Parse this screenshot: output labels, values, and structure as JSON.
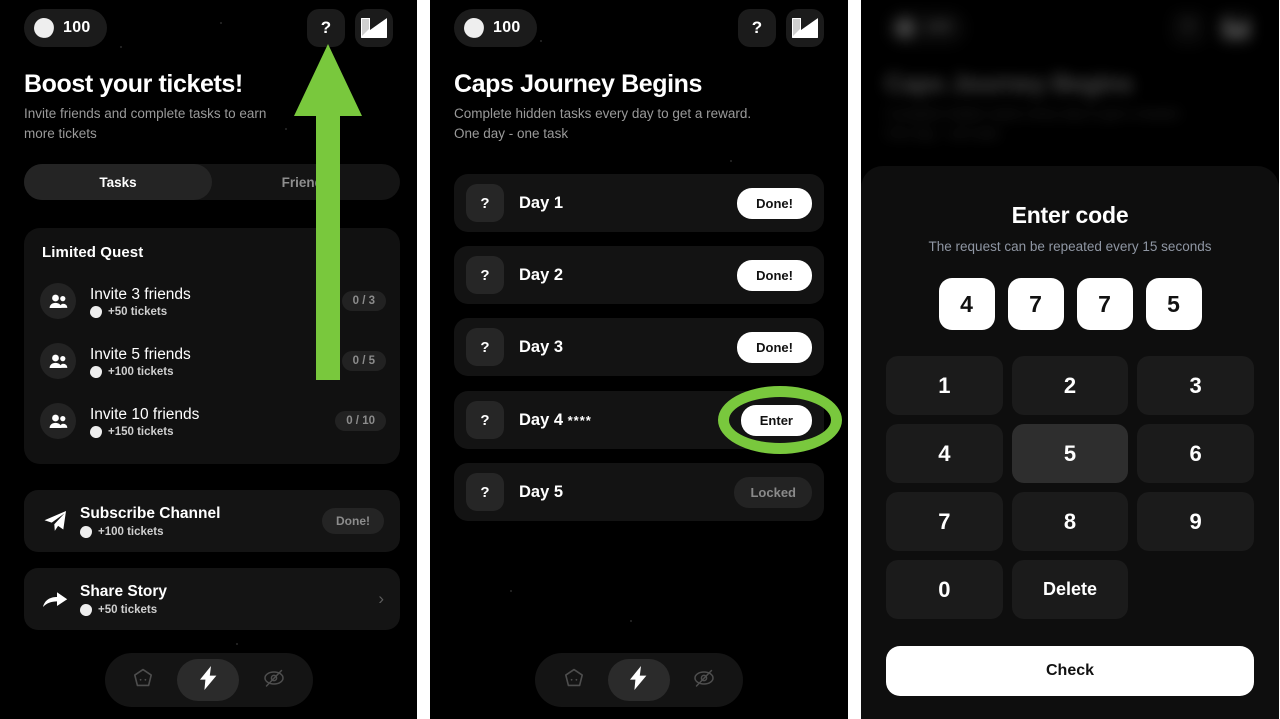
{
  "theme": {
    "accent_green": "#79c83d",
    "panel_bg": "#000000",
    "card_bg": "#111111",
    "text_primary": "#ffffff",
    "text_muted": "#9a9a9a"
  },
  "panel1": {
    "balance": "100",
    "help_label": "?",
    "title": "Boost your tickets!",
    "subtitle": "Invite friends and complete tasks to earn more tickets",
    "tabs": [
      {
        "label": "Tasks",
        "active": true
      },
      {
        "label": "Friends",
        "active": false
      }
    ],
    "quest_card": {
      "title": "Limited Quest",
      "rows": [
        {
          "name": "Invite 3 friends",
          "reward": "+50 tickets",
          "progress": "0 / 3"
        },
        {
          "name": "Invite 5 friends",
          "reward": "+100 tickets",
          "progress": "0 / 5"
        },
        {
          "name": "Invite 10 friends",
          "reward": "+150 tickets",
          "progress": "0 / 10"
        }
      ]
    },
    "tasks": [
      {
        "name": "Subscribe Channel",
        "reward": "+100 tickets",
        "status": "Done!"
      },
      {
        "name": "Share Story",
        "reward": "+50 tickets",
        "status": ""
      }
    ],
    "nav": [
      {
        "icon": "home-icon",
        "active": false
      },
      {
        "icon": "lightning-icon",
        "active": true
      },
      {
        "icon": "eye-off-icon",
        "active": false
      }
    ]
  },
  "panel2": {
    "balance": "100",
    "help_label": "?",
    "title": "Caps Journey Begins",
    "subtitle_line1": "Complete hidden tasks every day to get a reward.",
    "subtitle_line2": "One day - one task",
    "days": [
      {
        "icon": "?",
        "name": "Day 1",
        "stars": "",
        "action": "Done!",
        "state": "done"
      },
      {
        "icon": "?",
        "name": "Day 2",
        "stars": "",
        "action": "Done!",
        "state": "done"
      },
      {
        "icon": "?",
        "name": "Day 3",
        "stars": "",
        "action": "Done!",
        "state": "done"
      },
      {
        "icon": "?",
        "name": "Day 4",
        "stars": "****",
        "action": "Enter",
        "state": "enter"
      },
      {
        "icon": "?",
        "name": "Day 5",
        "stars": "",
        "action": "Locked",
        "state": "locked"
      }
    ]
  },
  "panel3": {
    "background_title": "Caps Journey Begins",
    "background_subtitle_line1": "Complete hidden tasks every day to get a reward.",
    "background_subtitle_line2": "One day - one task",
    "background_balance": "100",
    "sheet": {
      "title": "Enter code",
      "subtitle": "The request can be repeated every 15 seconds",
      "code": [
        "4",
        "7",
        "7",
        "5"
      ],
      "keys": [
        {
          "label": "1",
          "pressed": false
        },
        {
          "label": "2",
          "pressed": false
        },
        {
          "label": "3",
          "pressed": false
        },
        {
          "label": "4",
          "pressed": false
        },
        {
          "label": "5",
          "pressed": true
        },
        {
          "label": "6",
          "pressed": false
        },
        {
          "label": "7",
          "pressed": false
        },
        {
          "label": "8",
          "pressed": false
        },
        {
          "label": "9",
          "pressed": false
        },
        {
          "label": "0",
          "pressed": false
        },
        {
          "label": "Delete",
          "pressed": false
        }
      ],
      "submit_label": "Check"
    }
  }
}
